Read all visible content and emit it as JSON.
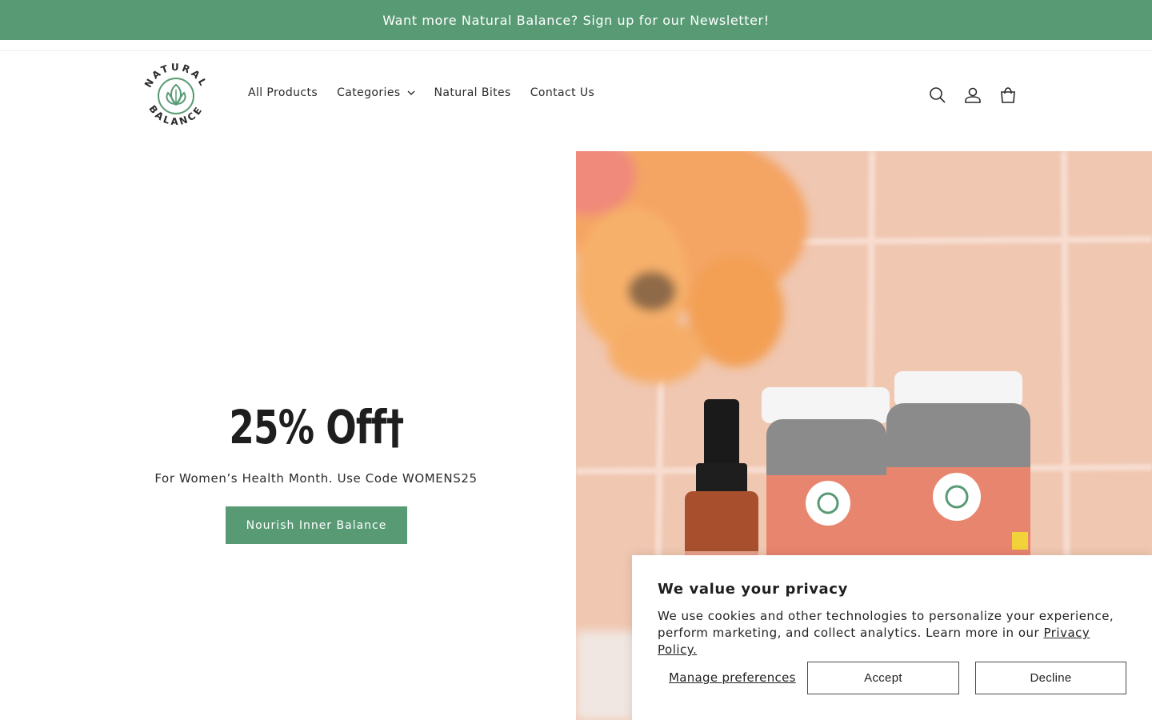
{
  "announcement": {
    "text": "Want more Natural Balance? Sign up for our Newsletter!"
  },
  "brand": {
    "logo_top": "NATURAL",
    "logo_bottom": "BALANCE",
    "accent": "#579a74"
  },
  "nav": {
    "items": [
      {
        "label": "All Products"
      },
      {
        "label": "Categories"
      },
      {
        "label": "Natural Bites"
      },
      {
        "label": "Contact Us"
      }
    ]
  },
  "header_icons": [
    "search-icon",
    "account-icon",
    "cart-icon"
  ],
  "hero": {
    "title": "25% Off†",
    "subtitle": "For Women’s Health Month. Use Code WOMENS25",
    "cta": "Nourish Inner Balance",
    "image_colors": {
      "tile": "#efc4ad",
      "grout": "#f6ddd0",
      "flower": "#f5a55c",
      "bottle_label": "#e9887a"
    }
  },
  "cookie_banner": {
    "title": "We value your privacy",
    "text": "We use cookies and other technologies to personalize your experience, perform marketing, and collect analytics. Learn more in our",
    "link": "Privacy Policy.",
    "manage": "Manage preferences",
    "accept": "Accept",
    "decline": "Decline"
  }
}
